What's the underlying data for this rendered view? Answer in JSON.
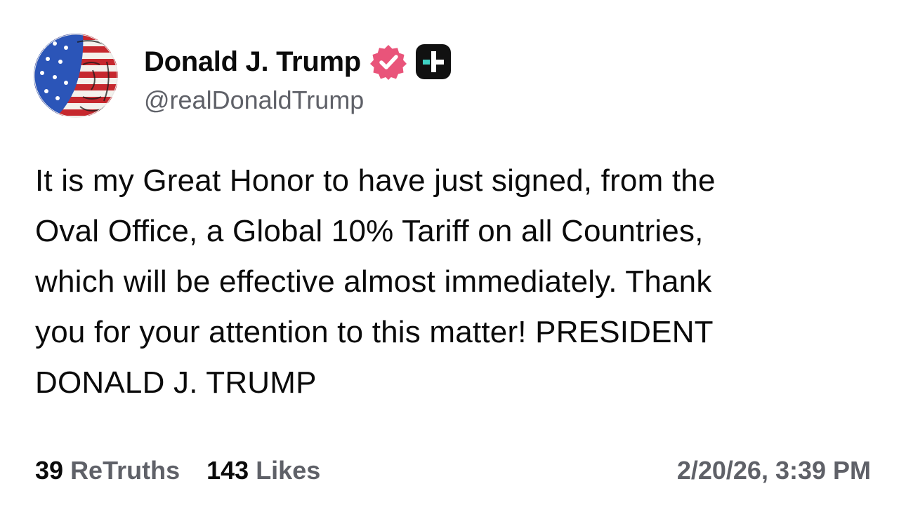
{
  "author": {
    "display_name": "Donald J. Trump",
    "handle": "@realDonaldTrump",
    "avatar_icon": "flag-portrait-avatar",
    "verified_icon": "verified-badge-icon",
    "plus_icon": "plus-badge-icon"
  },
  "post": {
    "lines": [
      "It is my Great Honor to have just signed, from the",
      "Oval Office, a Global 10% Tariff on all Countries,",
      "which will be effective almost immediately. Thank",
      "you for your attention to this matter! PRESIDENT",
      "DONALD J. TRUMP"
    ]
  },
  "stats": {
    "retruths_count": "39",
    "retruths_label": "ReTruths",
    "likes_count": "143",
    "likes_label": "Likes"
  },
  "timestamp": "2/20/26, 3:39 PM",
  "colors": {
    "verified_badge": "#e9547a",
    "plus_badge_bg": "#111111",
    "plus_badge_accent": "#3fd3c5",
    "secondary_text": "#5f6168"
  }
}
